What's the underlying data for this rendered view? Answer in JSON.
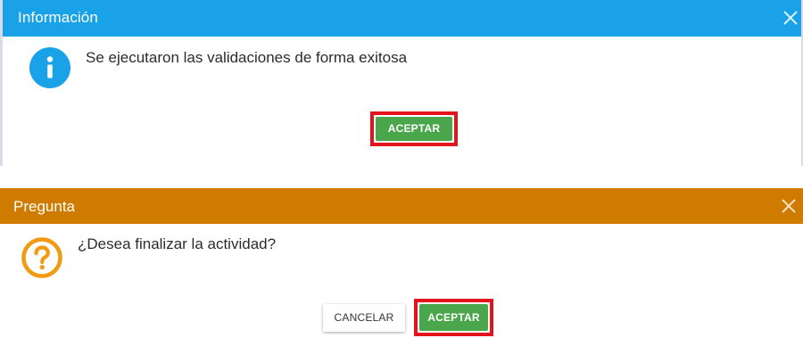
{
  "info_dialog": {
    "title": "Información",
    "message": "Se ejecutaron las validaciones de forma exitosa",
    "accept_label": "ACEPTAR",
    "icon": "info-icon",
    "header_color": "#1aa2e8"
  },
  "question_dialog": {
    "title": "Pregunta",
    "message": "¿Desea finalizar la actividad?",
    "cancel_label": "CANCELAR",
    "accept_label": "ACEPTAR",
    "icon": "question-icon",
    "header_color": "#cf7b00"
  },
  "colors": {
    "accept_button": "#4aa64a",
    "highlight_border": "#e4141c",
    "info_icon": "#1aa2e8",
    "question_icon": "#f29a12"
  }
}
